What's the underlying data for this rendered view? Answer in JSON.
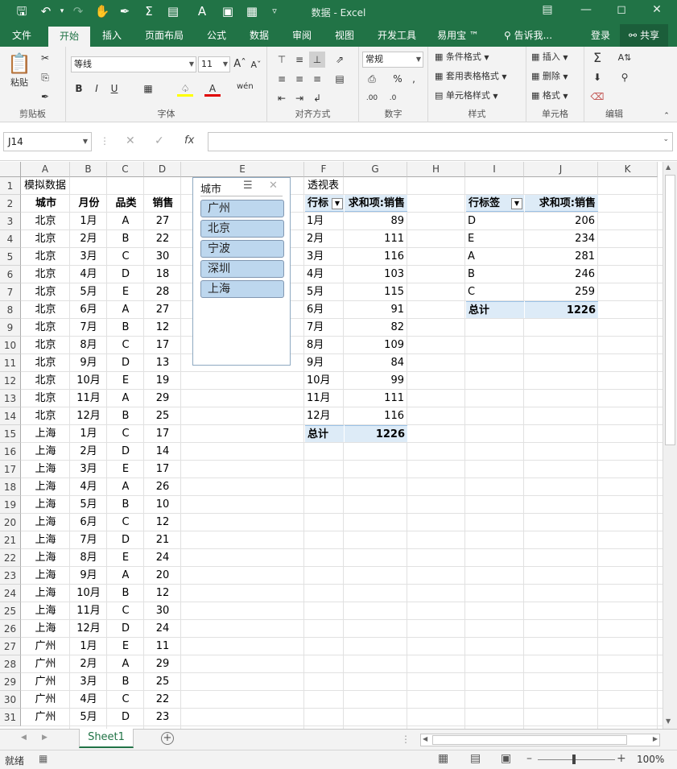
{
  "app": {
    "title": "数据 - Excel"
  },
  "ribbon_tabs": [
    {
      "label": "文件"
    },
    {
      "label": "开始"
    },
    {
      "label": "插入"
    },
    {
      "label": "页面布局"
    },
    {
      "label": "公式"
    },
    {
      "label": "数据"
    },
    {
      "label": "审阅"
    },
    {
      "label": "视图"
    },
    {
      "label": "开发工具"
    },
    {
      "label": "易用宝 ™"
    }
  ],
  "tellme": "告诉我...",
  "login": "登录",
  "share": "共享",
  "ribbon": {
    "paste": "粘贴",
    "font_name": "等线",
    "font_size": "11",
    "bold": "B",
    "italic": "I",
    "underline": "U",
    "number_format": "常规",
    "cond_format": "条件格式",
    "table_format": "套用表格格式",
    "cell_style": "单元格样式",
    "insert": "插入",
    "delete": "删除",
    "format": "格式",
    "groups": {
      "clipboard": "剪贴板",
      "font": "字体",
      "align": "对齐方式",
      "number": "数字",
      "styles": "样式",
      "cells": "单元格",
      "edit": "编辑"
    }
  },
  "namebox": "J14",
  "columns": [
    "A",
    "B",
    "C",
    "D",
    "E",
    "F",
    "G",
    "H",
    "I",
    "J",
    "K"
  ],
  "rows": [
    "1",
    "2",
    "3",
    "4",
    "5",
    "6",
    "7",
    "8",
    "9",
    "10",
    "11",
    "12",
    "13",
    "14",
    "15",
    "16",
    "17",
    "18",
    "19",
    "20",
    "21",
    "22",
    "23",
    "24",
    "25",
    "26",
    "27",
    "28",
    "29",
    "30",
    "31"
  ],
  "source": {
    "title": "模拟数据",
    "headers": [
      "城市",
      "月份",
      "品类",
      "销售"
    ],
    "rows": [
      [
        "北京",
        "1月",
        "A",
        "27"
      ],
      [
        "北京",
        "2月",
        "B",
        "22"
      ],
      [
        "北京",
        "3月",
        "C",
        "30"
      ],
      [
        "北京",
        "4月",
        "D",
        "18"
      ],
      [
        "北京",
        "5月",
        "E",
        "28"
      ],
      [
        "北京",
        "6月",
        "A",
        "27"
      ],
      [
        "北京",
        "7月",
        "B",
        "12"
      ],
      [
        "北京",
        "8月",
        "C",
        "17"
      ],
      [
        "北京",
        "9月",
        "D",
        "13"
      ],
      [
        "北京",
        "10月",
        "E",
        "19"
      ],
      [
        "北京",
        "11月",
        "A",
        "29"
      ],
      [
        "北京",
        "12月",
        "B",
        "25"
      ],
      [
        "上海",
        "1月",
        "C",
        "17"
      ],
      [
        "上海",
        "2月",
        "D",
        "14"
      ],
      [
        "上海",
        "3月",
        "E",
        "17"
      ],
      [
        "上海",
        "4月",
        "A",
        "26"
      ],
      [
        "上海",
        "5月",
        "B",
        "10"
      ],
      [
        "上海",
        "6月",
        "C",
        "12"
      ],
      [
        "上海",
        "7月",
        "D",
        "21"
      ],
      [
        "上海",
        "8月",
        "E",
        "24"
      ],
      [
        "上海",
        "9月",
        "A",
        "20"
      ],
      [
        "上海",
        "10月",
        "B",
        "12"
      ],
      [
        "上海",
        "11月",
        "C",
        "30"
      ],
      [
        "上海",
        "12月",
        "D",
        "24"
      ],
      [
        "广州",
        "1月",
        "E",
        "11"
      ],
      [
        "广州",
        "2月",
        "A",
        "29"
      ],
      [
        "广州",
        "3月",
        "B",
        "25"
      ],
      [
        "广州",
        "4月",
        "C",
        "22"
      ],
      [
        "广州",
        "5月",
        "D",
        "23"
      ]
    ]
  },
  "slicer": {
    "title": "城市",
    "items": [
      "广州",
      "北京",
      "宁波",
      "深圳",
      "上海"
    ]
  },
  "pivot1": {
    "title": "透视表",
    "header_label": "行标",
    "header_value": "求和项:销售",
    "rows": [
      [
        "1月",
        "89"
      ],
      [
        "2月",
        "111"
      ],
      [
        "3月",
        "116"
      ],
      [
        "4月",
        "103"
      ],
      [
        "5月",
        "115"
      ],
      [
        "6月",
        "91"
      ],
      [
        "7月",
        "82"
      ],
      [
        "8月",
        "109"
      ],
      [
        "9月",
        "84"
      ],
      [
        "10月",
        "99"
      ],
      [
        "11月",
        "111"
      ],
      [
        "12月",
        "116"
      ]
    ],
    "total_label": "总计",
    "total": "1226"
  },
  "pivot2": {
    "header_label": "行标签",
    "header_value": "求和项:销售",
    "rows": [
      [
        "D",
        "206"
      ],
      [
        "E",
        "234"
      ],
      [
        "A",
        "281"
      ],
      [
        "B",
        "246"
      ],
      [
        "C",
        "259"
      ]
    ],
    "total_label": "总计",
    "total": "1226"
  },
  "sheet_tab": "Sheet1",
  "status": {
    "ready": "就绪",
    "zoom": "100%"
  }
}
